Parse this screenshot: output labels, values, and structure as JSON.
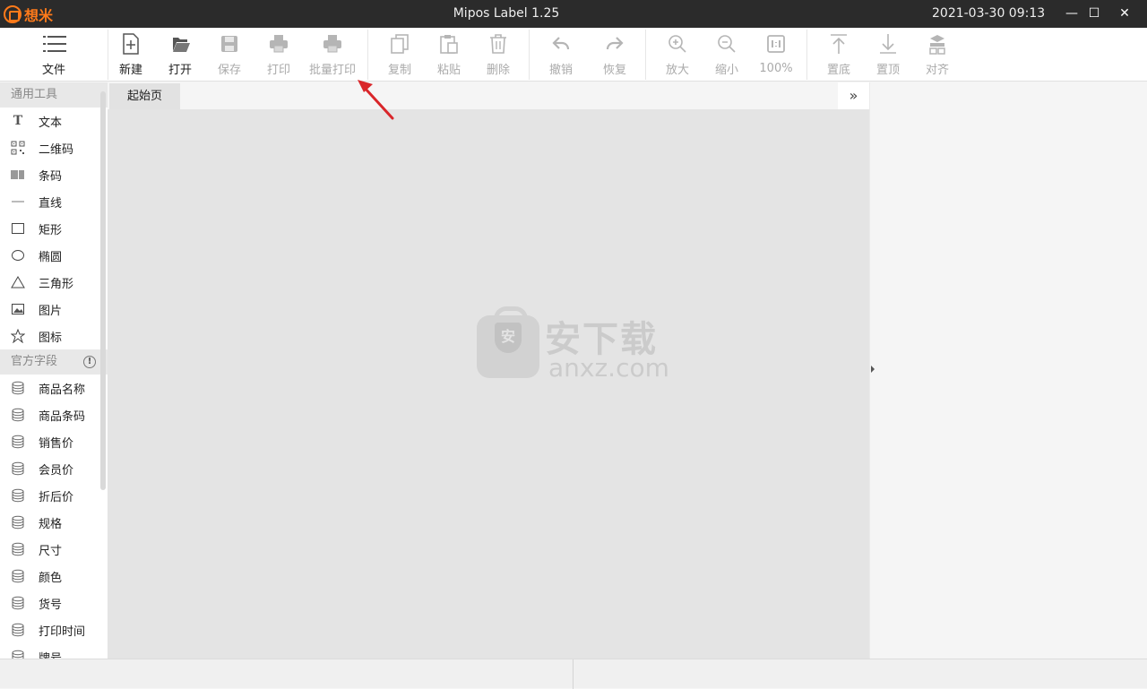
{
  "titlebar": {
    "brand": "想米",
    "title": "Mipos Label 1.25",
    "datetime": "2021-03-30 09:13",
    "minimize": "—",
    "maximize": "☐",
    "close": "✕"
  },
  "toolbar": {
    "file": "文件",
    "new": "新建",
    "open": "打开",
    "save": "保存",
    "print": "打印",
    "batch_print": "批量打印",
    "copy": "复制",
    "paste": "粘贴",
    "delete": "删除",
    "undo": "撤销",
    "redo": "恢复",
    "zoom_in": "放大",
    "zoom_out": "缩小",
    "zoom_level": "100%",
    "to_bottom": "置底",
    "to_top": "置顶",
    "align": "对齐"
  },
  "left_panel": {
    "general_tools": {
      "title": "通用工具",
      "items": [
        {
          "label": "文本",
          "icon": "text-icon"
        },
        {
          "label": "二维码",
          "icon": "qrcode-icon"
        },
        {
          "label": "条码",
          "icon": "barcode-icon"
        },
        {
          "label": "直线",
          "icon": "line-icon"
        },
        {
          "label": "矩形",
          "icon": "rectangle-icon"
        },
        {
          "label": "椭圆",
          "icon": "ellipse-icon"
        },
        {
          "label": "三角形",
          "icon": "triangle-icon"
        },
        {
          "label": "图片",
          "icon": "image-icon"
        },
        {
          "label": "图标",
          "icon": "star-icon"
        }
      ]
    },
    "official_fields": {
      "title": "官方字段",
      "items": [
        {
          "label": "商品名称",
          "icon": "database-icon"
        },
        {
          "label": "商品条码",
          "icon": "database-icon"
        },
        {
          "label": "销售价",
          "icon": "database-icon"
        },
        {
          "label": "会员价",
          "icon": "database-icon"
        },
        {
          "label": "折后价",
          "icon": "database-icon"
        },
        {
          "label": "规格",
          "icon": "database-icon"
        },
        {
          "label": "尺寸",
          "icon": "database-icon"
        },
        {
          "label": "颜色",
          "icon": "database-icon"
        },
        {
          "label": "货号",
          "icon": "database-icon"
        },
        {
          "label": "打印时间",
          "icon": "database-icon"
        },
        {
          "label": "牌号",
          "icon": "database-icon"
        }
      ]
    }
  },
  "tabs": [
    {
      "label": "起始页"
    }
  ],
  "more_button": "»",
  "watermark": {
    "cn": "安下载",
    "en": "anxz.com",
    "shield": "安"
  },
  "colors": {
    "titlebar_bg": "#2b2b2b",
    "brand": "#ff7a1a",
    "canvas_bg": "#e4e4e4",
    "annotation": "#d9262a"
  }
}
